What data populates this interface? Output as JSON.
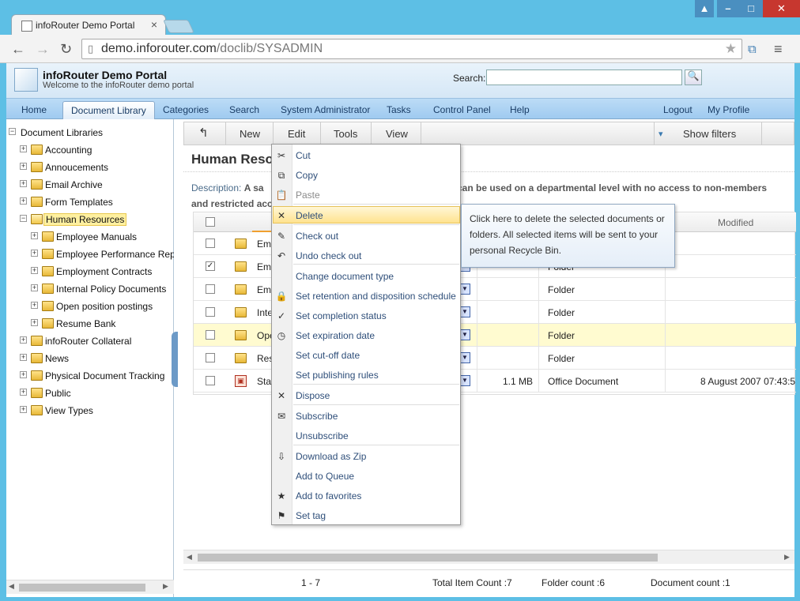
{
  "browser": {
    "tab_title": "infoRouter Demo Portal",
    "url_host": "demo.inforouter.com",
    "url_path": "/doclib/SYSADMIN"
  },
  "header": {
    "title": "infoRouter Demo Portal",
    "subtitle": "Welcome to the infoRouter demo portal",
    "search_label": "Search:",
    "search_value": ""
  },
  "menu": {
    "home": "Home",
    "document_library": "Document Library",
    "categories": "Categories",
    "search": "Search",
    "system_administrator": "System Administrator",
    "tasks": "Tasks",
    "control_panel": "Control Panel",
    "help": "Help",
    "logout": "Logout",
    "my_profile": "My Profile"
  },
  "tree": {
    "root": "Document Libraries",
    "items": [
      "Accounting",
      "Annoucements",
      "Email Archive",
      "Form Templates",
      "Human Resources",
      "Employee Manuals",
      "Employee Performance Repo",
      "Employment Contracts",
      "Internal Policy Documents",
      "Open position postings",
      "Resume Bank",
      "infoRouter Collateral",
      "News",
      "Physical Document Tracking",
      "Public",
      "View Types"
    ]
  },
  "toolbar": {
    "new": "New",
    "edit": "Edit",
    "tools": "Tools",
    "view": "View",
    "show_filters": "Show filters"
  },
  "content": {
    "heading": "Human Reso",
    "desc_label": "Description:",
    "desc_a": "A sa",
    "desc_b": "can be used on a departmental level with no access to non-members",
    "desc_c": "and restricted acc",
    "col_modified": "Modified"
  },
  "rows": [
    {
      "name": "Emp",
      "size": "",
      "type": "",
      "modified": "",
      "checked": false
    },
    {
      "name": "Emp",
      "size": "",
      "type": "Folder",
      "modified": "",
      "checked": true
    },
    {
      "name": "Emp",
      "size": "",
      "type": "Folder",
      "modified": "",
      "checked": false
    },
    {
      "name": "Inte",
      "size": "",
      "type": "Folder",
      "modified": "",
      "checked": false
    },
    {
      "name": "Ope",
      "size": "",
      "type": "Folder",
      "modified": "",
      "checked": false
    },
    {
      "name": "Resu",
      "size": "",
      "type": "Folder",
      "modified": "",
      "checked": false
    },
    {
      "name": "Staf",
      "size": "1.1 MB",
      "type": "Office Document",
      "modified": "8 August 2007 07:43:5",
      "checked": false
    }
  ],
  "status": {
    "range": "1 - 7",
    "total": "Total Item Count :7",
    "folders": "Folder count :6",
    "documents": "Document count :1"
  },
  "context_menu": {
    "items": [
      {
        "label": "Cut",
        "icon": "scissors-icon",
        "glyph": "✂"
      },
      {
        "label": "Copy",
        "icon": "copy-icon",
        "glyph": "⧉"
      },
      {
        "label": "Paste",
        "icon": "paste-icon",
        "glyph": "📋"
      },
      {
        "label": "Delete",
        "icon": "delete-icon",
        "glyph": "✕"
      },
      {
        "label": "Check out",
        "icon": "check-out-icon",
        "glyph": "✎"
      },
      {
        "label": "Undo check out",
        "icon": "undo-icon",
        "glyph": "↶"
      },
      {
        "label": "Change document type",
        "icon": "",
        "glyph": ""
      },
      {
        "label": "Set retention and disposition schedule",
        "icon": "lock-icon",
        "glyph": "🔒"
      },
      {
        "label": "Set completion status",
        "icon": "status-icon",
        "glyph": "✓"
      },
      {
        "label": "Set expiration date",
        "icon": "clock-icon",
        "glyph": "◷"
      },
      {
        "label": "Set cut-off date",
        "icon": "",
        "glyph": ""
      },
      {
        "label": "Set publishing rules",
        "icon": "",
        "glyph": ""
      },
      {
        "label": "Dispose",
        "icon": "dispose-icon",
        "glyph": "✕"
      },
      {
        "label": "Subscribe",
        "icon": "subscribe-icon",
        "glyph": "✉"
      },
      {
        "label": "Unsubscribe",
        "icon": "",
        "glyph": ""
      },
      {
        "label": "Download as Zip",
        "icon": "zip-icon",
        "glyph": "⇩"
      },
      {
        "label": "Add to Queue",
        "icon": "",
        "glyph": ""
      },
      {
        "label": "Add to favorites",
        "icon": "favorites-icon",
        "glyph": "★"
      },
      {
        "label": "Set tag",
        "icon": "flag-icon",
        "glyph": "⚑"
      }
    ],
    "tooltip": "Click here to delete the selected documents or folders. All selected items will be sent to your personal Recycle Bin."
  }
}
